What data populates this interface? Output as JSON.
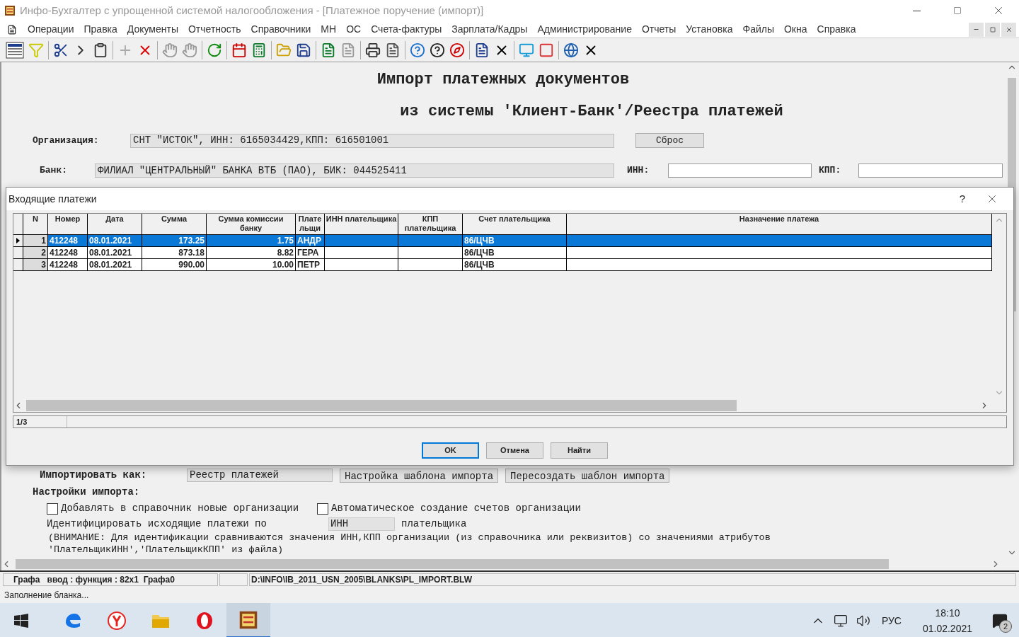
{
  "window": {
    "title": "Инфо-Бухгалтер с упрощенной системой налогообложения - [Платежное поручение (импорт)]"
  },
  "menu": [
    "Операции",
    "Правка",
    "Документы",
    "Отчетность",
    "Справочники",
    "МН",
    "ОС",
    "Счета-фактуры",
    "Зарплата/Кадры",
    "Администрирование",
    "Отчеты",
    "Установка",
    "Файлы",
    "Окна",
    "Справка"
  ],
  "form": {
    "title_lines": [
      "Импорт платежных документов",
      "из системы 'Клиент-Банк'/Реестра платежей"
    ],
    "organization": {
      "label": "Организация:",
      "value": "СНТ \"ИСТОК\", ИНН: 6165034429,КПП: 616501001"
    },
    "reset_button": "Сброс",
    "bank": {
      "label": "Банк:",
      "value": "ФИЛИАЛ \"ЦЕНТРАЛЬНЫЙ\" БАНКА ВТБ (ПАО), БИК: 044525411"
    },
    "inn": {
      "label": "ИНН:"
    },
    "kpp": {
      "label": "КПП:"
    },
    "import_as": {
      "label": "Импортировать как:",
      "value": "Реестр платежей",
      "buttons": [
        "Настройка шаблона импорта",
        "Пересоздать шаблон импорта"
      ]
    },
    "settings": {
      "title": "Настройки импорта:",
      "checkboxes": [
        {
          "label": "Добавлять в справочник новые организации",
          "checked": false
        },
        {
          "label": "Автоматическое создание счетов организации",
          "checked": false
        }
      ],
      "identify": {
        "prefix": "Идентифицировать исходящие платежи по",
        "value": "ИНН",
        "suffix": "плательщика"
      },
      "note_lines": [
        "(ВНИМАНИЕ: Для идентификации сравниваются значения ИНН,КПП организации (из справочника или реквизитов) со значениями атрибутов",
        "'ПлательщикИНН','ПлательщикКПП' из файла)"
      ]
    }
  },
  "dialog": {
    "title": "Входящие платежи",
    "help": "?",
    "columns": [
      "N",
      "Номер",
      "Дата",
      "Сумма",
      "Сумма комиссии банку",
      "Плате льщи",
      "ИНН плательщика",
      "КПП плательщика",
      "Счет плательщика",
      "Назначение платежа"
    ],
    "rows": [
      {
        "selected": true,
        "cells": [
          "1",
          "412248",
          "08.01.2021",
          "173.25",
          "1.75",
          "АНДР",
          "",
          "",
          "86/ЦЧВ",
          ""
        ]
      },
      {
        "selected": false,
        "cells": [
          "2",
          "412248",
          "08.01.2021",
          "873.18",
          "8.82",
          "ГЕРА",
          "",
          "",
          "86/ЦЧВ",
          ""
        ]
      },
      {
        "selected": false,
        "cells": [
          "3",
          "412248",
          "08.01.2021",
          "990.00",
          "10.00",
          "ПЕТР",
          "",
          "",
          "86/ЦЧВ",
          ""
        ]
      }
    ],
    "pager": "1/3",
    "buttons": [
      {
        "label": "OK",
        "default": true
      },
      {
        "label": "Отмена",
        "default": false
      },
      {
        "label": "Найти",
        "default": false
      }
    ]
  },
  "status_bar": {
    "fields": [
      "Графа   ввод : функция : 82x1  Графа0",
      "D:\\INFO\\IB_2011_USN_2005\\BLANKS\\PL_IMPORT.BLW"
    ],
    "message": "Заполнение бланка..."
  },
  "taskbar": {
    "apps": [
      {
        "kind": "edge",
        "selected": false
      },
      {
        "kind": "yandex",
        "selected": false
      },
      {
        "kind": "folder",
        "selected": false
      },
      {
        "kind": "opera",
        "selected": false
      },
      {
        "kind": "abacus",
        "selected": true
      }
    ],
    "language": "РУС",
    "time": "18:10",
    "date": "01.02.2021",
    "notifications": "2"
  }
}
